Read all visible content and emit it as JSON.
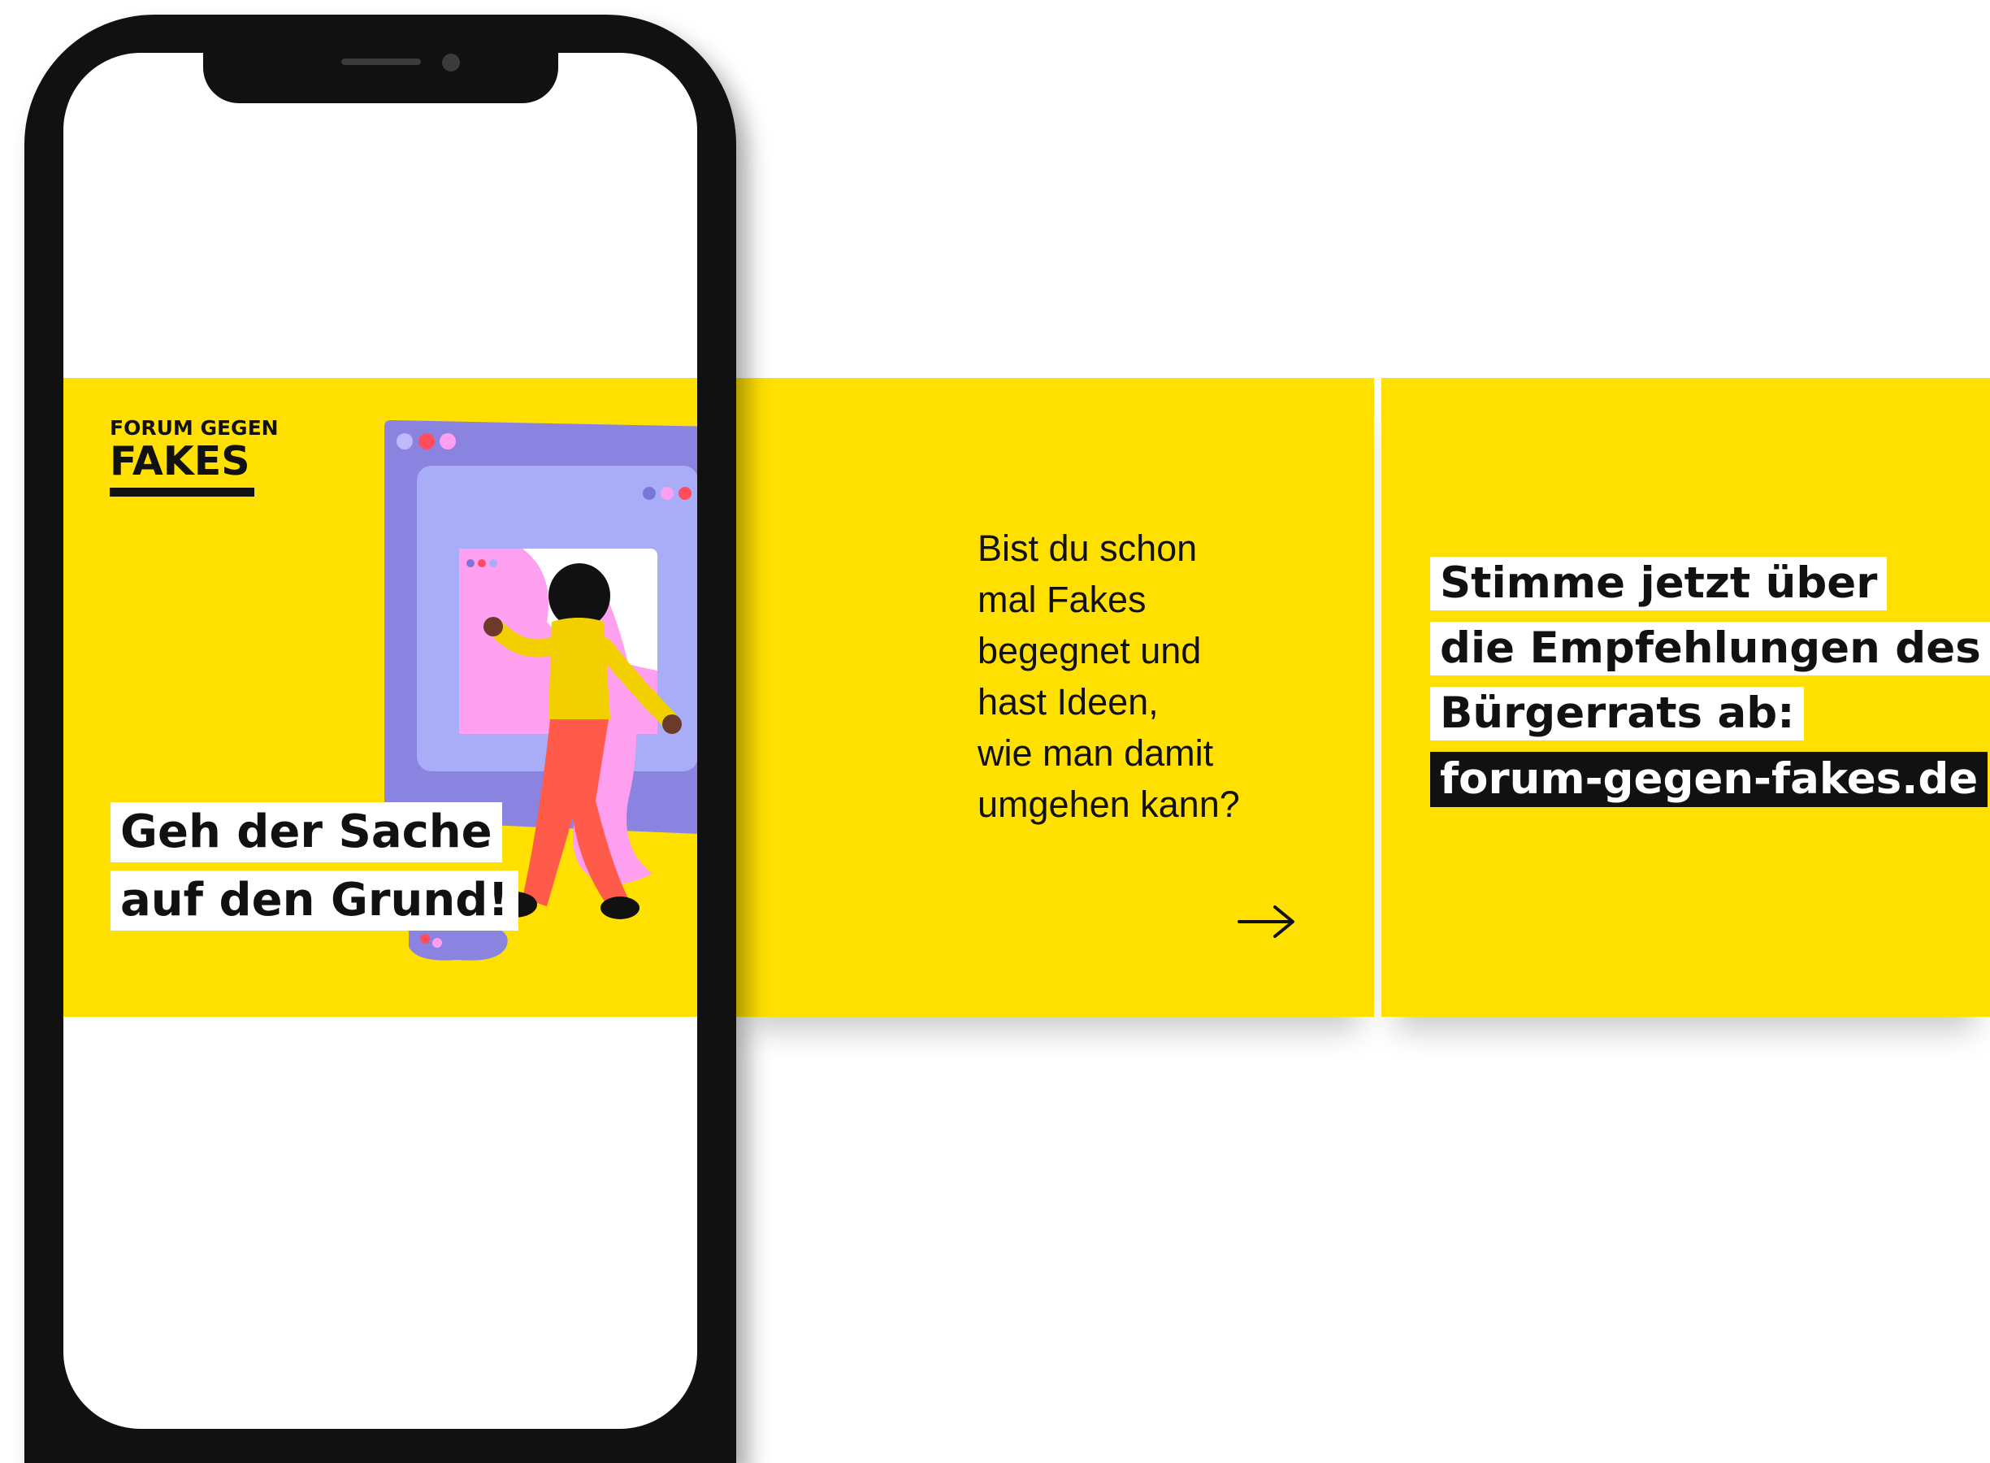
{
  "slide1": {
    "logo": {
      "line1": "FORUM GEGEN",
      "line2": "FAKES"
    },
    "headline": [
      "Geh der Sache",
      "auf den Grund!"
    ]
  },
  "slide2": {
    "lines": [
      "Bist du schon",
      "mal Fakes",
      "begegnet und",
      "hast Ideen,",
      "wie man damit",
      "umgehen kann?"
    ],
    "arrow_icon": "arrow-right-icon"
  },
  "slide3": {
    "lines": [
      "Stimme jetzt über",
      "die Empfehlungen des",
      "Bürgerrats ab:"
    ],
    "url": "forum-gegen-fakes.de"
  },
  "colors": {
    "brand_yellow": "#ffe000",
    "text_dark": "#111111",
    "highlight_white": "#ffffff",
    "window_outer": "#8a84e0",
    "window_inner": "#a9adf7",
    "pink": "#ff9ff0",
    "orange_red": "#ff5a4a"
  }
}
